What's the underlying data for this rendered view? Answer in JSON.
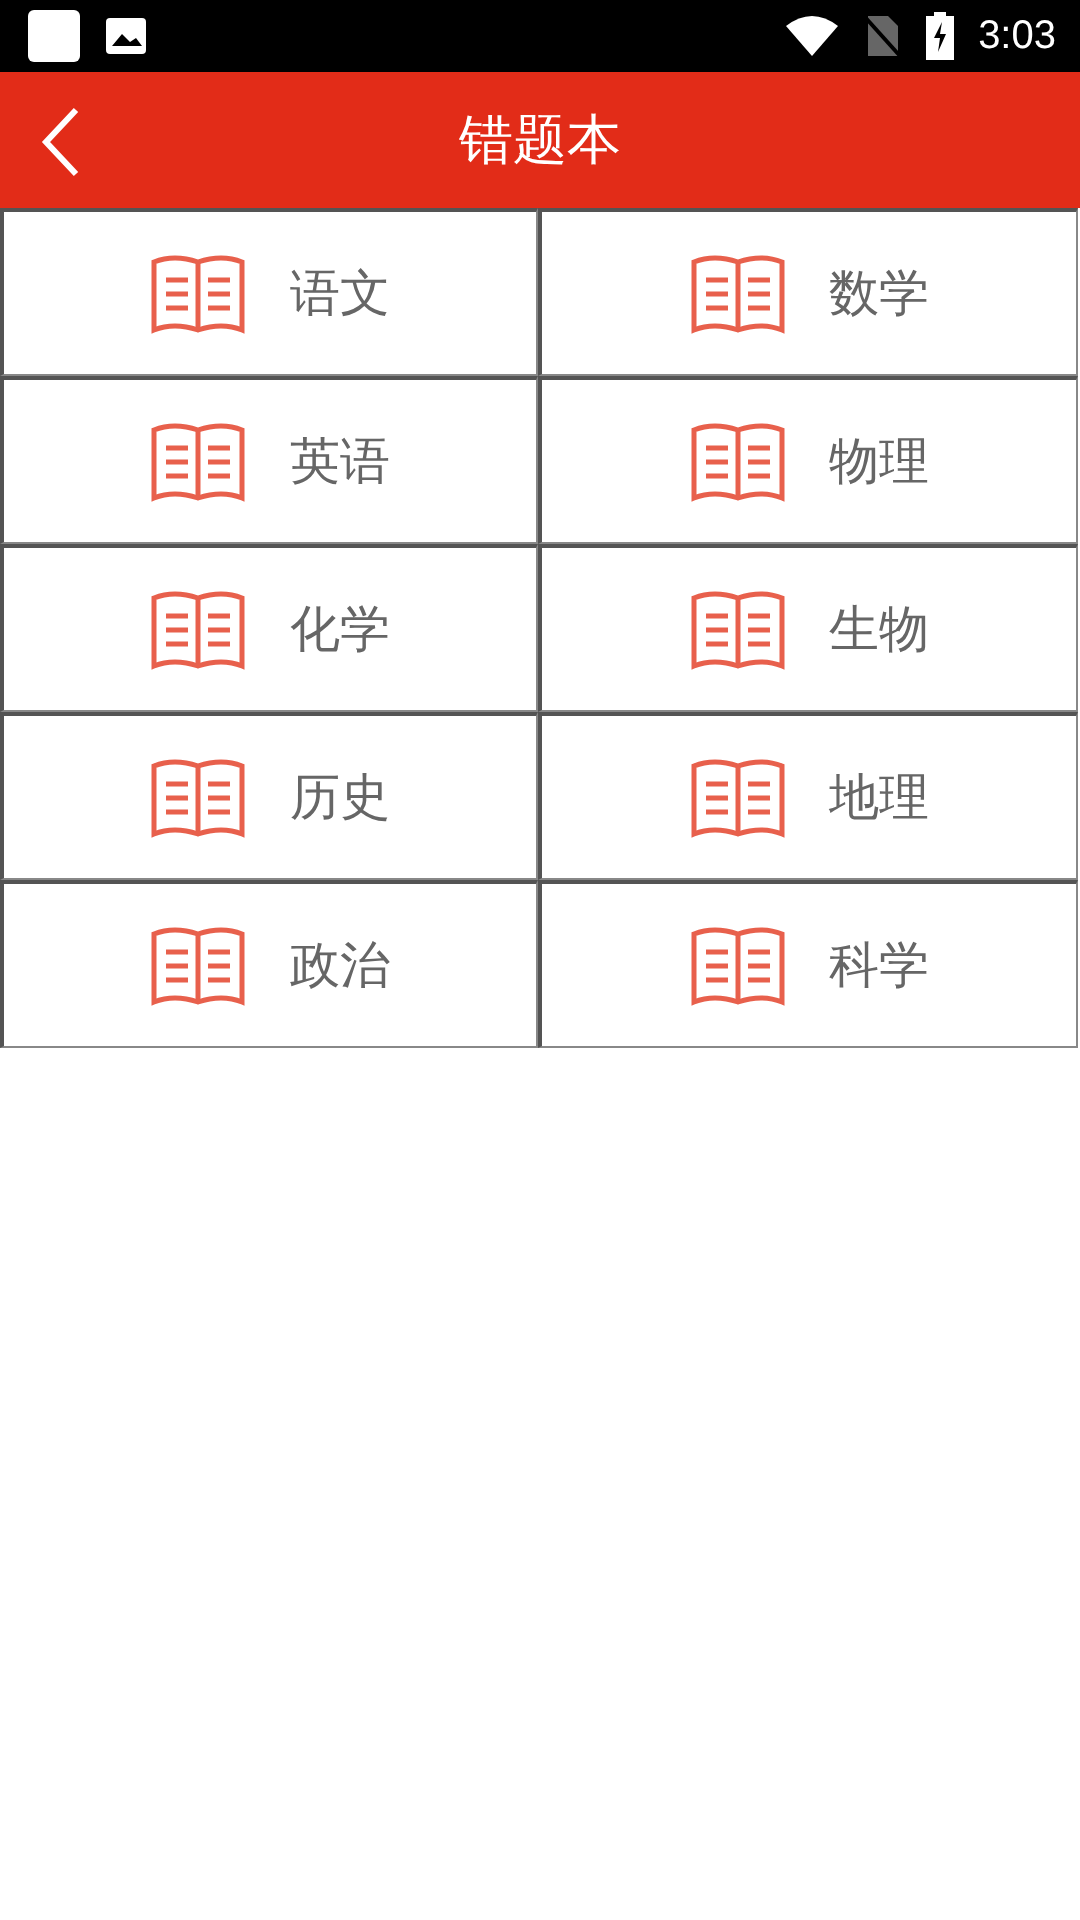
{
  "status_bar": {
    "time": "3:03"
  },
  "app_bar": {
    "title": "错题本"
  },
  "subjects": [
    {
      "label": "语文"
    },
    {
      "label": "数学"
    },
    {
      "label": "英语"
    },
    {
      "label": "物理"
    },
    {
      "label": "化学"
    },
    {
      "label": "生物"
    },
    {
      "label": "历史"
    },
    {
      "label": "地理"
    },
    {
      "label": "政治"
    },
    {
      "label": "科学"
    }
  ]
}
